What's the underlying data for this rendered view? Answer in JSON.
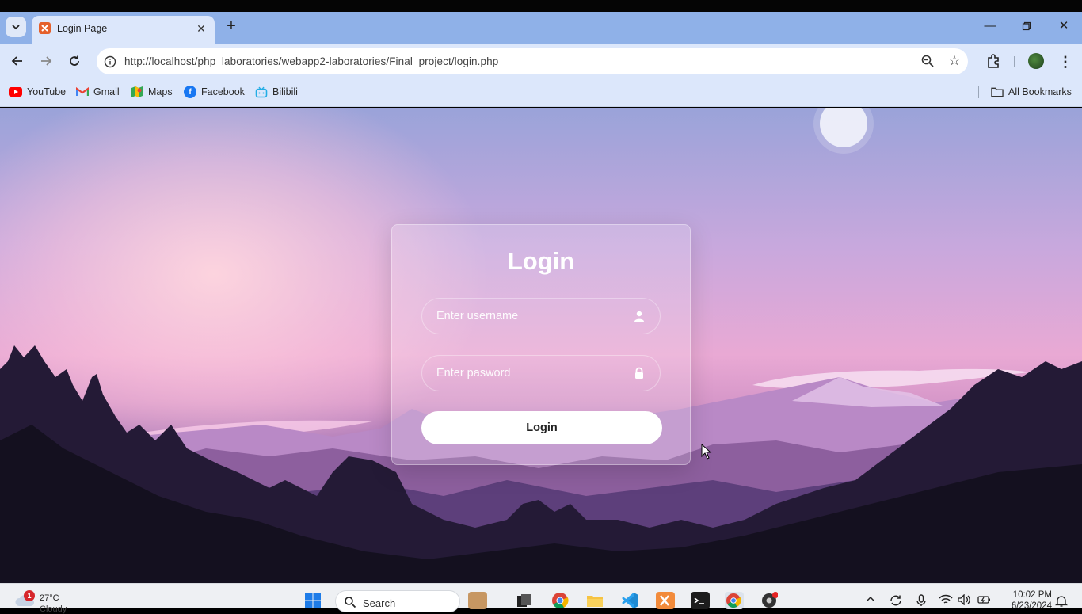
{
  "browser": {
    "tab": {
      "title": "Login Page"
    },
    "address_bar": {
      "url": "http://localhost/php_laboratories/webapp2-laboratories/Final_project/login.php"
    },
    "bookmarks": [
      {
        "label": "YouTube",
        "icon": "youtube-icon",
        "color": "#ff0000"
      },
      {
        "label": "Gmail",
        "icon": "gmail-icon",
        "color": "#ea4335"
      },
      {
        "label": "Maps",
        "icon": "maps-icon",
        "color": "#34a853"
      },
      {
        "label": "Facebook",
        "icon": "facebook-icon",
        "color": "#1877f2"
      },
      {
        "label": "Bilibili",
        "icon": "bilibili-icon",
        "color": "#23ade5"
      }
    ],
    "all_bookmarks_label": "All Bookmarks"
  },
  "login": {
    "heading": "Login",
    "username_placeholder": "Enter username",
    "password_placeholder": "Enter pasword",
    "button_label": "Login"
  },
  "taskbar": {
    "weather": {
      "badge": "1",
      "temp": "27°C",
      "condition": "Cloudy"
    },
    "search_label": "Search",
    "clock": {
      "time": "10:02 PM",
      "date": "6/23/2024"
    }
  }
}
